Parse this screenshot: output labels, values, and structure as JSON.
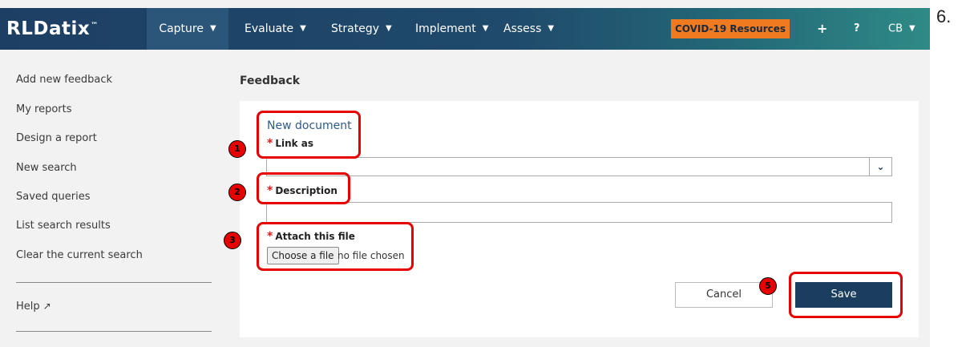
{
  "brand": {
    "logo_text": "RLDatix",
    "trademark": "™"
  },
  "nav": {
    "items": [
      {
        "label": "Capture",
        "active": true
      },
      {
        "label": "Evaluate"
      },
      {
        "label": "Strategy"
      },
      {
        "label": "Implement"
      },
      {
        "label": "Assess"
      }
    ],
    "covid_label": "COVID-19 Resources",
    "add_icon": "+",
    "help_icon": "?",
    "user_initials": "CB"
  },
  "sidebar": {
    "links": [
      "Add new feedback",
      "My reports",
      "Design a report",
      "New search",
      "Saved queries",
      "List search results",
      "Clear the current search"
    ],
    "help_label": "Help"
  },
  "main": {
    "page_title": "Feedback",
    "form": {
      "doc_title": "New document",
      "link_as_label": "Link as",
      "link_as_value": "",
      "description_label": "Description",
      "description_value": "",
      "attach_label": "Attach this file",
      "file_button_label": "Choose a file",
      "file_status": "no file chosen",
      "required_marker": "*"
    },
    "cancel_label": "Cancel",
    "save_label": "Save"
  },
  "annotations": {
    "markers": [
      "1",
      "2",
      "3",
      "5"
    ],
    "step_number": "6."
  },
  "colors": {
    "topbar_start": "#1d3f63",
    "topbar_end": "#2f8a86",
    "covid_orange": "#f07a20",
    "save_navy": "#1b3e5e",
    "highlight_red": "#e60000",
    "link_blue": "#2f5b8a"
  }
}
